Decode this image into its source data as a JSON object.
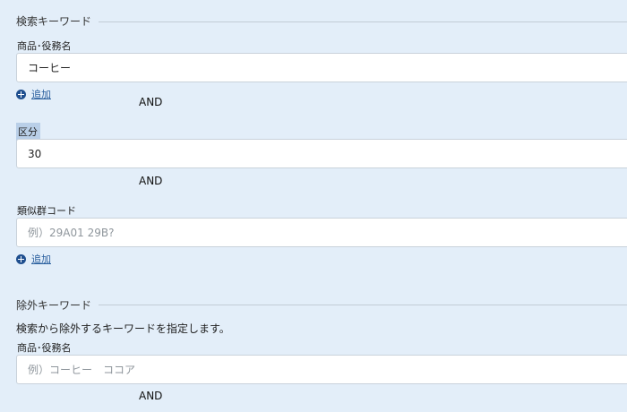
{
  "search_keywords": {
    "title": "検索キーワード",
    "product_service": {
      "label": "商品･役務名",
      "value": "コーヒー",
      "add_label": "追加"
    },
    "operator_1": "AND",
    "category": {
      "label": "区分",
      "value": "30"
    },
    "operator_2": "AND",
    "similar_group": {
      "label": "類似群コード",
      "value": "",
      "placeholder": "例）29A01 29B?",
      "add_label": "追加"
    }
  },
  "exclude_keywords": {
    "title": "除外キーワード",
    "description": "検索から除外するキーワードを指定します。",
    "product_service": {
      "label": "商品･役務名",
      "value": "",
      "placeholder": "例）コーヒー　ココア"
    },
    "operator_1": "AND"
  },
  "icons": {
    "add": "plus-circle-icon"
  },
  "colors": {
    "background": "#e3eef9",
    "link": "#2a5f9e",
    "label_highlight": "#b9cfe8",
    "input_border": "#c9d2db"
  }
}
